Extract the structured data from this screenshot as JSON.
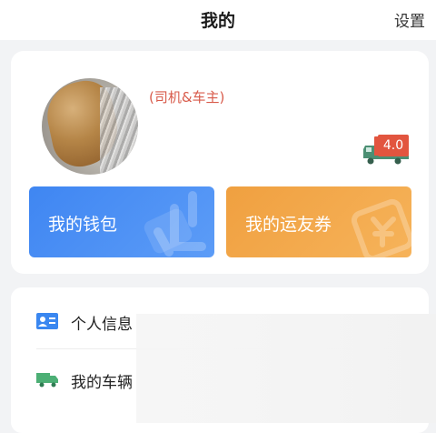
{
  "header": {
    "title": "我的",
    "settings_label": "设置"
  },
  "profile": {
    "avatar": "user-avatar",
    "role": "(司机&车主)",
    "level": "4.0"
  },
  "shortcuts": {
    "wallet_label": "我的钱包",
    "coupon_label": "我的运友券"
  },
  "menu": {
    "items": [
      {
        "label": "个人信息",
        "icon": "id-card-icon"
      },
      {
        "label": "我的车辆",
        "icon": "truck-icon"
      }
    ]
  },
  "colors": {
    "background": "#f2f3f5",
    "role_text": "#d85b4b",
    "wallet_blue": "#3f86f2",
    "coupon_orange": "#f0a040",
    "badge_red": "#e2553f",
    "id_icon_blue": "#3a87f0",
    "truck_icon_green": "#4caf75"
  }
}
